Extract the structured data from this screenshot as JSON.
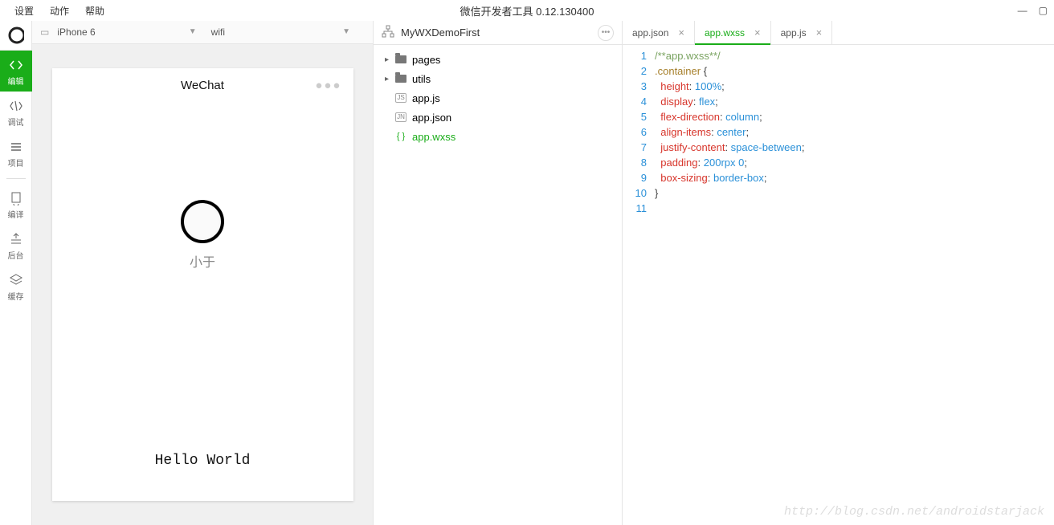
{
  "menubar": {
    "items": [
      "设置",
      "动作",
      "帮助"
    ],
    "title": "微信开发者工具 0.12.130400"
  },
  "sidebar": {
    "items": [
      {
        "id": "globe",
        "label": ""
      },
      {
        "id": "edit",
        "label": "编辑"
      },
      {
        "id": "debug",
        "label": "调试"
      },
      {
        "id": "project",
        "label": "项目"
      },
      {
        "id": "compile",
        "label": "编译"
      },
      {
        "id": "backend",
        "label": "后台"
      },
      {
        "id": "cache",
        "label": "缓存"
      }
    ]
  },
  "device": {
    "model": "iPhone 6",
    "network": "wifi"
  },
  "simulator": {
    "title": "WeChat",
    "username": "小于",
    "hello": "Hello World"
  },
  "project": {
    "name": "MyWXDemoFirst",
    "tree": [
      {
        "type": "folder",
        "name": "pages"
      },
      {
        "type": "folder",
        "name": "utils"
      },
      {
        "type": "file",
        "name": "app.js",
        "badge": "JS"
      },
      {
        "type": "file",
        "name": "app.json",
        "badge": "JN"
      },
      {
        "type": "file",
        "name": "app.wxss",
        "badge": "{}",
        "active": true
      }
    ]
  },
  "editor": {
    "tabs": [
      {
        "name": "app.json",
        "active": false
      },
      {
        "name": "app.wxss",
        "active": true
      },
      {
        "name": "app.js",
        "active": false
      }
    ],
    "code": [
      {
        "n": 1,
        "tokens": [
          {
            "t": "/**app.wxss**/",
            "c": "comment"
          }
        ]
      },
      {
        "n": 2,
        "tokens": [
          {
            "t": ".container ",
            "c": "sel"
          },
          {
            "t": "{",
            "c": "punct"
          }
        ]
      },
      {
        "n": 3,
        "tokens": [
          {
            "t": "  ",
            "c": ""
          },
          {
            "t": "height",
            "c": "prop"
          },
          {
            "t": ": ",
            "c": "punct"
          },
          {
            "t": "100%",
            "c": "val"
          },
          {
            "t": ";",
            "c": "punct"
          }
        ]
      },
      {
        "n": 4,
        "tokens": [
          {
            "t": "  ",
            "c": ""
          },
          {
            "t": "display",
            "c": "prop"
          },
          {
            "t": ": ",
            "c": "punct"
          },
          {
            "t": "flex",
            "c": "val"
          },
          {
            "t": ";",
            "c": "punct"
          }
        ]
      },
      {
        "n": 5,
        "tokens": [
          {
            "t": "  ",
            "c": ""
          },
          {
            "t": "flex-direction",
            "c": "prop"
          },
          {
            "t": ": ",
            "c": "punct"
          },
          {
            "t": "column",
            "c": "val"
          },
          {
            "t": ";",
            "c": "punct"
          }
        ]
      },
      {
        "n": 6,
        "tokens": [
          {
            "t": "  ",
            "c": ""
          },
          {
            "t": "align-items",
            "c": "prop"
          },
          {
            "t": ": ",
            "c": "punct"
          },
          {
            "t": "center",
            "c": "val"
          },
          {
            "t": ";",
            "c": "punct"
          }
        ]
      },
      {
        "n": 7,
        "tokens": [
          {
            "t": "  ",
            "c": ""
          },
          {
            "t": "justify-content",
            "c": "prop"
          },
          {
            "t": ": ",
            "c": "punct"
          },
          {
            "t": "space-between",
            "c": "val"
          },
          {
            "t": ";",
            "c": "punct"
          }
        ]
      },
      {
        "n": 8,
        "tokens": [
          {
            "t": "  ",
            "c": ""
          },
          {
            "t": "padding",
            "c": "prop"
          },
          {
            "t": ": ",
            "c": "punct"
          },
          {
            "t": "200rpx 0",
            "c": "val"
          },
          {
            "t": ";",
            "c": "punct"
          }
        ]
      },
      {
        "n": 9,
        "tokens": [
          {
            "t": "  ",
            "c": ""
          },
          {
            "t": "box-sizing",
            "c": "prop"
          },
          {
            "t": ": ",
            "c": "punct"
          },
          {
            "t": "border-box",
            "c": "val"
          },
          {
            "t": ";",
            "c": "punct"
          }
        ]
      },
      {
        "n": 10,
        "tokens": [
          {
            "t": "}",
            "c": "punct"
          }
        ]
      },
      {
        "n": 11,
        "tokens": [
          {
            "t": "",
            "c": ""
          }
        ]
      }
    ]
  },
  "watermark": "http://blog.csdn.net/androidstarjack"
}
